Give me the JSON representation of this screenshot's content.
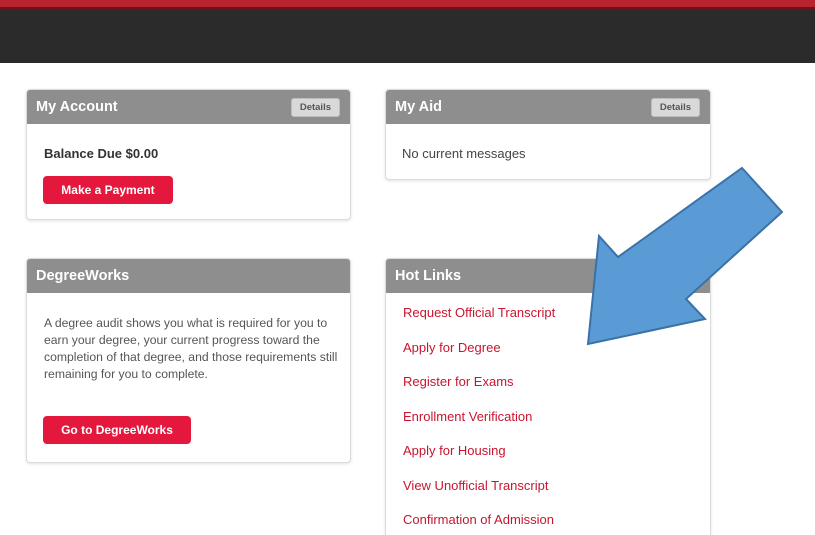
{
  "account": {
    "title": "My Account",
    "details_label": "Details",
    "balance": "Balance Due $0.00",
    "pay_label": "Make a Payment"
  },
  "aid": {
    "title": "My Aid",
    "details_label": "Details",
    "message": "No current messages"
  },
  "degreeworks": {
    "title": "DegreeWorks",
    "description": "A degree audit shows you what is required for you to earn your degree, your current progress toward the completion of that degree, and those requirements still remaining for you to complete.",
    "button_label": "Go to DegreeWorks"
  },
  "hotlinks": {
    "title": "Hot Links",
    "items": [
      "Request Official Transcript",
      "Apply for Degree",
      "Register for Exams",
      "Enrollment Verification",
      "Apply for Housing",
      "View Unofficial Transcript",
      "Confirmation of Admission"
    ]
  },
  "colors": {
    "accent_red": "#e4173d",
    "link_red": "#c8152f",
    "header_gray": "#8e8e8e",
    "topbar": "#2b2b2b",
    "arrow_blue": "#5b9bd5"
  },
  "annotation": {
    "icon": "arrow-pointer-icon"
  }
}
